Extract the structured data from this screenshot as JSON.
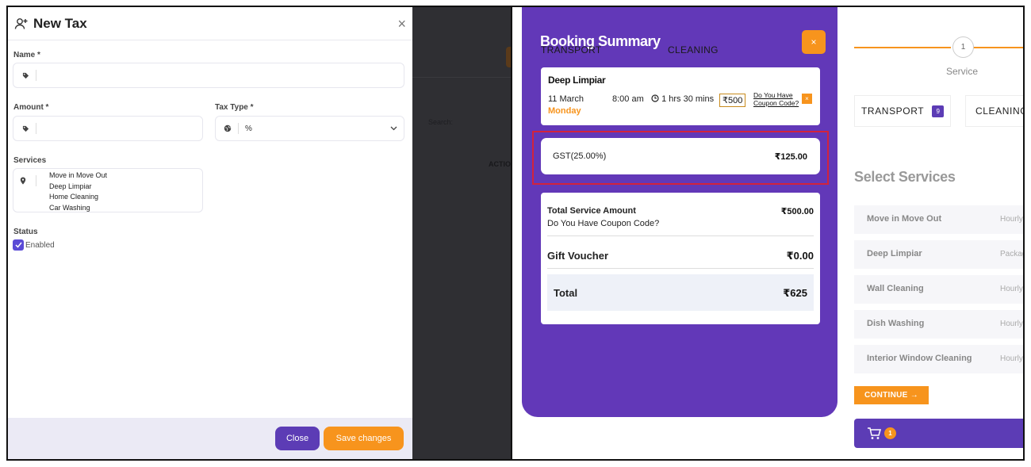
{
  "new_tax_modal": {
    "title": "New Tax",
    "close_glyph": "×",
    "name_label": "Name *",
    "name_value": "",
    "amount_label": "Amount *",
    "amount_value": "",
    "tax_type_label": "Tax Type *",
    "tax_type_value": "%",
    "services_label": "Services",
    "services": [
      "Move in Move Out",
      "Deep Limpiar",
      "Home Cleaning",
      "Car Washing"
    ],
    "status_label": "Status",
    "status_option": "Enabled",
    "status_checked": true,
    "close_button": "Close",
    "save_button": "Save changes",
    "icons": {
      "header": "add-user-icon",
      "name": "tag-icon",
      "amount": "tag-icon",
      "tax_type": "globe-icon",
      "services": "map-pin-icon"
    }
  },
  "background_page": {
    "search_label": "Search:",
    "column_header": "ACTIO"
  },
  "booking_summary": {
    "title": "Booking Summary",
    "category_tabs": [
      "TRANSPORT",
      "CLEANING"
    ],
    "close_glyph": "×",
    "item": {
      "name": "Deep Limpiar",
      "date": "11 March",
      "day": "Monday",
      "time": "8:00 am",
      "duration": "1 hrs 30 mins",
      "price": "₹500",
      "coupon_link": "Do You Have Coupon Code?",
      "remove_glyph": "×"
    },
    "tax": {
      "label": "GST(25.00%)",
      "amount": "₹125.00"
    },
    "totals": {
      "service_amount_label": "Total Service Amount",
      "service_amount": "₹500.00",
      "coupon_question": "Do You Have Coupon Code?",
      "gift_voucher_label": "Gift Voucher",
      "gift_voucher": "₹0.00",
      "total_label": "Total",
      "total": "₹625"
    }
  },
  "service_page": {
    "step_number": "1",
    "step_label": "Service",
    "tabs": [
      {
        "label": "TRANSPORT",
        "count": "9"
      },
      {
        "label": "CLEANING"
      }
    ],
    "section_title": "Select Services",
    "services": [
      {
        "name": "Move in Move Out",
        "pricing": "Hourly"
      },
      {
        "name": "Deep Limpiar",
        "pricing": "Package"
      },
      {
        "name": "Wall Cleaning",
        "pricing": "Hourly"
      },
      {
        "name": "Dish Washing",
        "pricing": "Hourly"
      },
      {
        "name": "Interior Window Cleaning",
        "pricing": "Hourly"
      }
    ],
    "continue_button": "CONTINUE →",
    "cart_count": "1"
  },
  "colors": {
    "primary_purple": "#6238b8",
    "button_purple": "#5c3cb5",
    "accent_orange": "#f7941d",
    "highlight_red": "#d2233c",
    "overlay_dark": "#2f2f33"
  }
}
